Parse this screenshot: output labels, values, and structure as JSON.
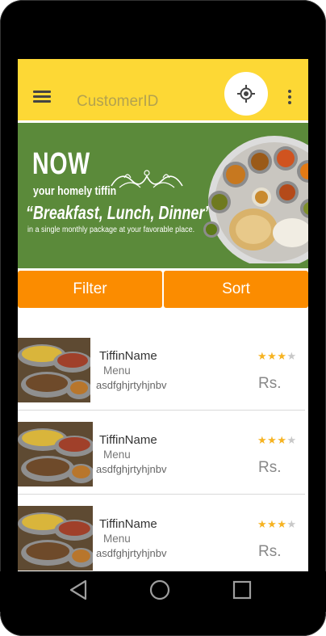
{
  "appbar": {
    "title": "CustomerID",
    "menu_icon": "hamburger-icon",
    "locate_icon": "my-location-icon",
    "overflow_icon": "more-vert-icon"
  },
  "banner": {
    "headline": "NOW",
    "subline": "your homely tiffin",
    "tagline": "“Breakfast, Lunch, Dinner”",
    "smallprint": "in a single monthly package at your favorable place."
  },
  "tabs": {
    "filter_label": "Filter",
    "sort_label": "Sort"
  },
  "items": [
    {
      "name": "TiffinName",
      "menu_label": "Menu",
      "description": "asdfghjrtyhjnbv",
      "rating": 3,
      "rating_max": 4,
      "price": "Rs."
    },
    {
      "name": "TiffinName",
      "menu_label": "Menu",
      "description": "asdfghjrtyhjnbv",
      "rating": 3,
      "rating_max": 4,
      "price": "Rs."
    },
    {
      "name": "TiffinName",
      "menu_label": "Menu",
      "description": "asdfghjrtyhjnbv",
      "rating": 3,
      "rating_max": 4,
      "price": "Rs."
    }
  ],
  "navbar": {
    "back_icon": "back-triangle-icon",
    "home_icon": "home-circle-icon",
    "recents_icon": "recents-square-icon"
  },
  "colors": {
    "appbar": "#fdd835",
    "tabs": "#fb8c00",
    "banner": "#5b8a3a",
    "star_on": "#f6b321",
    "star_off": "#c8c8c8"
  }
}
